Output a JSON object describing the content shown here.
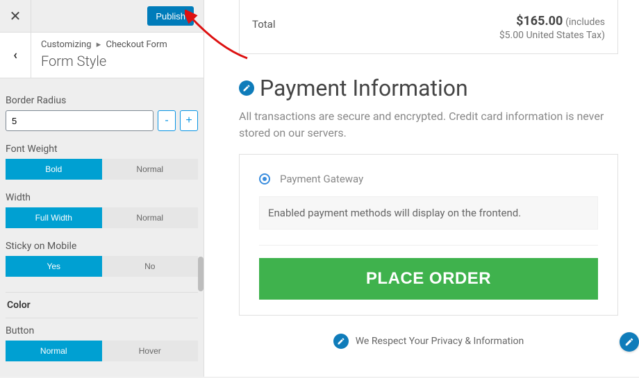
{
  "sidebar": {
    "close_glyph": "✕",
    "publish_label": "Publish",
    "back_glyph": "‹",
    "breadcrumb_root": "Customizing",
    "breadcrumb_sep": "▸",
    "breadcrumb_crumb": "Checkout Form",
    "section_title": "Form Style",
    "fields": {
      "border_radius": {
        "label": "Border Radius",
        "value": "5",
        "minus": "-",
        "plus": "+"
      },
      "font_weight": {
        "label": "Font Weight",
        "opt_a": "Bold",
        "opt_b": "Normal"
      },
      "width": {
        "label": "Width",
        "opt_a": "Full Width",
        "opt_b": "Normal"
      },
      "sticky": {
        "label": "Sticky on Mobile",
        "opt_a": "Yes",
        "opt_b": "No"
      }
    },
    "group_color": "Color",
    "button_group": {
      "label": "Button",
      "opt_a": "Normal",
      "opt_b": "Hover"
    }
  },
  "preview": {
    "total_label": "Total",
    "total_amount": "$165.00",
    "total_includes": "(includes",
    "total_tax_line": "$5.00 United States Tax)",
    "section_heading": "Payment Information",
    "subtext": "All transactions are secure and encrypted. Credit card information is never stored on our servers.",
    "gateway_label": "Payment Gateway",
    "gateway_note": "Enabled payment methods will display on the frontend.",
    "place_order": "PLACE ORDER",
    "privacy_text": "We Respect Your Privacy & Information"
  }
}
